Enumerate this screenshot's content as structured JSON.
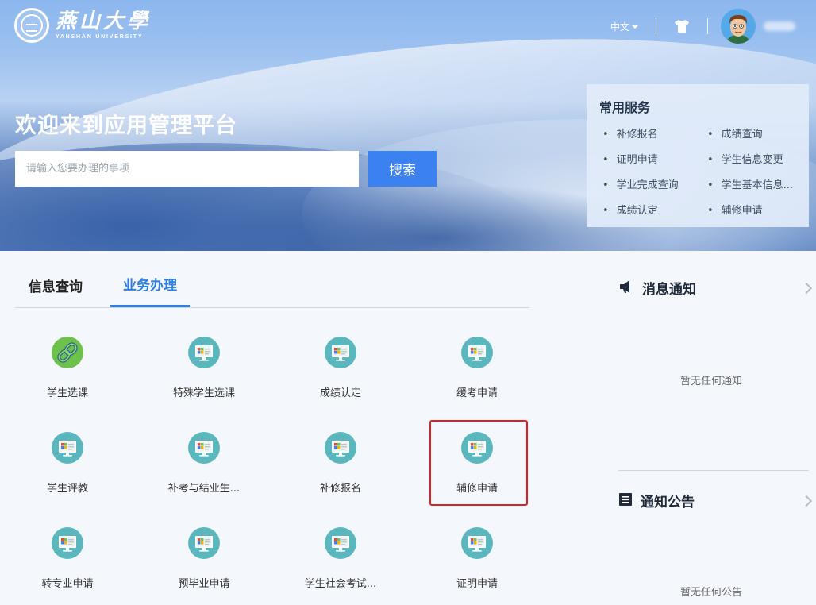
{
  "header": {
    "logo": {
      "name_cn": "燕山大學",
      "name_en": "YANSHAN UNIVERSITY"
    },
    "language": "中文",
    "icons": {
      "theme": "shirt-icon",
      "avatar": "avatar-icon"
    }
  },
  "hero": {
    "welcome": "欢迎来到应用管理平台",
    "search_placeholder": "请输入您要办理的事项",
    "search_button": "搜索"
  },
  "common_services": {
    "title": "常用服务",
    "items": [
      "补修报名",
      "成绩查询",
      "证明申请",
      "学生信息变更",
      "学业完成查询",
      "学生基本信息...",
      "成绩认定",
      "辅修申请"
    ]
  },
  "tabs": [
    {
      "label": "信息查询",
      "active": false
    },
    {
      "label": "业务办理",
      "active": true
    }
  ],
  "apps": [
    {
      "label": "学生选课",
      "icon": "link-icon"
    },
    {
      "label": "特殊学生选课",
      "icon": "monitor-icon"
    },
    {
      "label": "成绩认定",
      "icon": "monitor-icon"
    },
    {
      "label": "缓考申请",
      "icon": "monitor-icon"
    },
    {
      "label": "学生评教",
      "icon": "monitor-icon"
    },
    {
      "label": "补考与结业生...",
      "icon": "monitor-icon"
    },
    {
      "label": "补修报名",
      "icon": "monitor-icon"
    },
    {
      "label": "辅修申请",
      "icon": "monitor-icon",
      "highlighted": true
    },
    {
      "label": "转专业申请",
      "icon": "monitor-icon"
    },
    {
      "label": "预毕业申请",
      "icon": "monitor-icon"
    },
    {
      "label": "学生社会考试...",
      "icon": "monitor-icon"
    },
    {
      "label": "证明申请",
      "icon": "monitor-icon"
    }
  ],
  "right_panel": {
    "messages": {
      "title": "消息通知",
      "icon": "megaphone-icon",
      "empty_text": "暂无任何通知"
    },
    "announcements": {
      "title": "通知公告",
      "icon": "notice-icon",
      "empty_text": "暂无任何公告"
    }
  },
  "colors": {
    "accent": "#2f7de1",
    "button": "#3b82f0",
    "icon_teal": "#5bb7be",
    "link_green": "#6cc24a",
    "highlight": "#e02020"
  }
}
